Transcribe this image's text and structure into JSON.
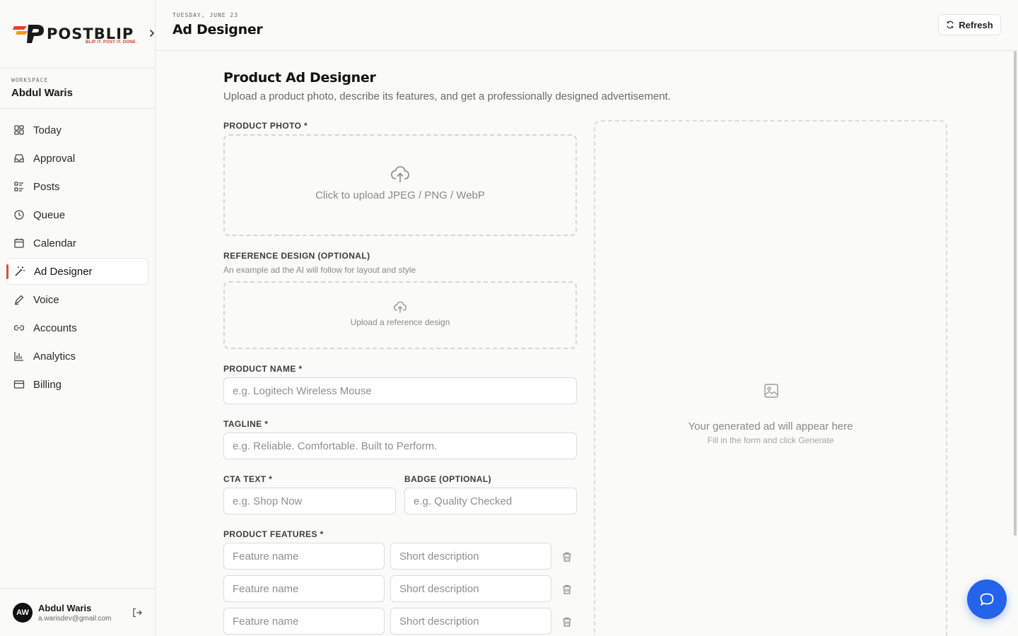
{
  "brand": {
    "name": "POSTBLIP",
    "tagline": "BLIP IT. POST IT. DONE.",
    "accent": "#d4532f"
  },
  "workspace": {
    "label": "WORKSPACE",
    "name": "Abdul Waris"
  },
  "nav": {
    "items": [
      {
        "label": "Today",
        "icon": "grid-icon"
      },
      {
        "label": "Approval",
        "icon": "inbox-icon"
      },
      {
        "label": "Posts",
        "icon": "list-icon"
      },
      {
        "label": "Queue",
        "icon": "clock-icon"
      },
      {
        "label": "Calendar",
        "icon": "calendar-icon"
      },
      {
        "label": "Ad Designer",
        "icon": "magic-wand-icon",
        "active": true
      },
      {
        "label": "Voice",
        "icon": "pen-icon"
      },
      {
        "label": "Accounts",
        "icon": "link-icon"
      },
      {
        "label": "Analytics",
        "icon": "bar-chart-icon"
      },
      {
        "label": "Billing",
        "icon": "credit-card-icon"
      }
    ]
  },
  "user": {
    "initials": "AW",
    "name": "Abdul Waris",
    "email": "a.warisdev@gmail.com"
  },
  "header": {
    "date": "TUESDAY, JUNE 23",
    "title": "Ad Designer",
    "refresh_label": "Refresh"
  },
  "form": {
    "title": "Product Ad Designer",
    "subtitle": "Upload a product photo, describe its features, and get a professionally designed advertisement.",
    "product_photo": {
      "label": "PRODUCT PHOTO *",
      "upload_text": "Click to upload JPEG / PNG / WebP"
    },
    "reference": {
      "label": "REFERENCE DESIGN (OPTIONAL)",
      "hint": "An example ad the AI will follow for layout and style",
      "upload_text": "Upload a reference design"
    },
    "product_name": {
      "label": "PRODUCT NAME *",
      "placeholder": "e.g. Logitech Wireless Mouse"
    },
    "tagline": {
      "label": "TAGLINE *",
      "placeholder": "e.g. Reliable. Comfortable. Built to Perform."
    },
    "cta": {
      "label": "CTA TEXT *",
      "placeholder": "e.g. Shop Now"
    },
    "badge": {
      "label": "BADGE (OPTIONAL)",
      "placeholder": "e.g. Quality Checked"
    },
    "features": {
      "label": "PRODUCT FEATURES *",
      "name_placeholder": "Feature name",
      "desc_placeholder": "Short description"
    }
  },
  "preview": {
    "title": "Your generated ad will appear here",
    "subtitle": "Fill in the form and click Generate"
  },
  "chat": {
    "icon": "chat-bubble-icon",
    "color": "#2563eb"
  }
}
